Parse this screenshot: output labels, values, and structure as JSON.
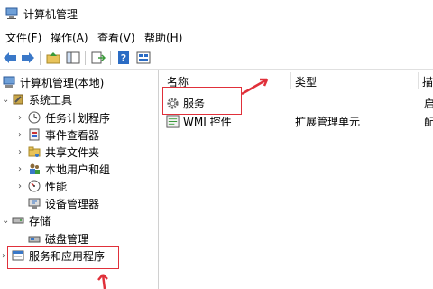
{
  "window": {
    "title": "计算机管理"
  },
  "menu": [
    "文件(F)",
    "操作(A)",
    "查看(V)",
    "帮助(H)"
  ],
  "toolbar": {
    "buttons": [
      "back-arrow-icon",
      "forward-arrow-icon",
      "up-folder-icon",
      "show-hide-tree-icon",
      "export-list-icon",
      "help-icon",
      "properties-icon"
    ]
  },
  "tree": {
    "root": "计算机管理(本地)",
    "system_tools": "系统工具",
    "task_scheduler": "任务计划程序",
    "event_viewer": "事件查看器",
    "shared_folders": "共享文件夹",
    "local_users": "本地用户和组",
    "performance": "性能",
    "device_manager": "设备管理器",
    "storage": "存储",
    "disk_management": "磁盘管理",
    "services_apps": "服务和应用程序"
  },
  "list": {
    "columns": [
      "名称",
      "类型",
      "描"
    ],
    "rows": [
      {
        "name": "服务",
        "type": "",
        "desc": "启"
      },
      {
        "name": "WMI 控件",
        "type": "扩展管理单元",
        "desc": "配"
      }
    ]
  },
  "colors": {
    "highlight": "#e0303a",
    "accent_blue": "#2b6cc4"
  }
}
